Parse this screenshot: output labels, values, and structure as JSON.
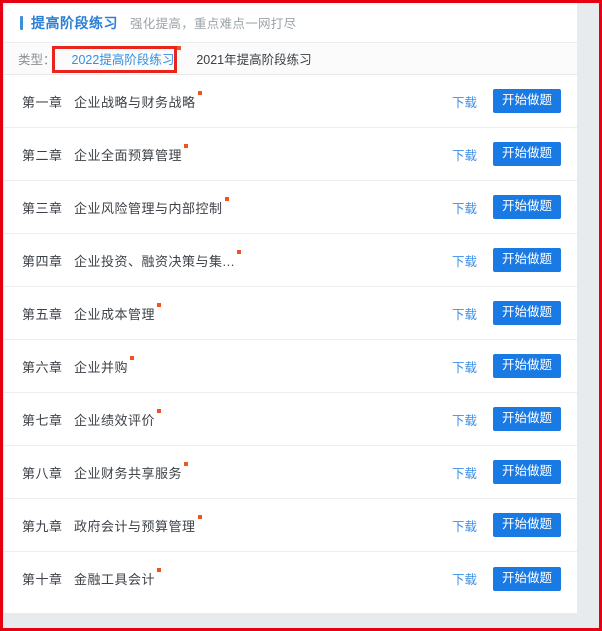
{
  "header": {
    "title": "提高阶段练习",
    "subtitle": "强化提高，重点难点一网打尽",
    "accent_color": "#2b7fd4"
  },
  "filter": {
    "label": "类型：",
    "tabs": [
      {
        "label": "2022提高阶段练习",
        "active": true,
        "has_dot": true
      },
      {
        "label": "2021年提高阶段练习",
        "active": false,
        "has_dot": false
      }
    ],
    "highlight_color": "#e8251c"
  },
  "list": {
    "download_label": "下载",
    "start_label": "开始做题",
    "button_color": "#1a7ae4",
    "link_color": "#3b8fe3",
    "dot_color": "#f5511e",
    "rows": [
      {
        "num": "第一章",
        "title": "企业战略与财务战略",
        "has_dot": true
      },
      {
        "num": "第二章",
        "title": "企业全面预算管理",
        "has_dot": true
      },
      {
        "num": "第三章",
        "title": "企业风险管理与内部控制",
        "has_dot": true
      },
      {
        "num": "第四章",
        "title": "企业投资、融资决策与集...",
        "has_dot": true
      },
      {
        "num": "第五章",
        "title": "企业成本管理",
        "has_dot": true
      },
      {
        "num": "第六章",
        "title": "企业并购",
        "has_dot": true
      },
      {
        "num": "第七章",
        "title": "企业绩效评价",
        "has_dot": true
      },
      {
        "num": "第八章",
        "title": "企业财务共享服务",
        "has_dot": true
      },
      {
        "num": "第九章",
        "title": "政府会计与预算管理",
        "has_dot": true
      },
      {
        "num": "第十章",
        "title": "金融工具会计",
        "has_dot": true
      }
    ]
  }
}
